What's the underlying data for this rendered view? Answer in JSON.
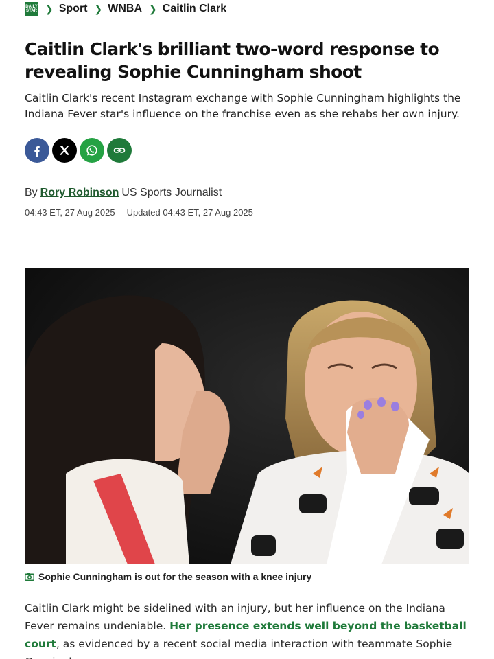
{
  "breadcrumb": {
    "logo_lines": [
      "DAILY",
      "STAR"
    ],
    "items": [
      "Sport",
      "WNBA",
      "Caitlin Clark"
    ]
  },
  "article": {
    "title": "Caitlin Clark's brilliant two-word response to revealing Sophie Cunningham shoot",
    "standfirst": "Caitlin Clark's recent Instagram exchange with Sophie Cunningham highlights the Indiana Fever star's influence on the franchise even as she rehabs her own injury.",
    "byline_prefix": "By",
    "author": "Rory Robinson",
    "author_role": "US Sports Journalist",
    "published": "04:43 ET, 27 Aug 2025",
    "updated": "Updated 04:43 ET, 27 Aug 2025",
    "caption": "Sophie Cunningham is out for the season with a knee injury",
    "body_before": "Caitlin Clark might be sidelined with an injury, but her influence on the Indiana Fever remains undeniable. ",
    "body_link": "Her presence extends well beyond the basketball court",
    "body_after": ", as evidenced by a recent social media interaction with teammate Sophie Cunningham."
  },
  "share": [
    "facebook-icon",
    "x-icon",
    "whatsapp-icon",
    "link-icon"
  ],
  "colors": {
    "brand_green": "#1f7a3a",
    "facebook": "#3b5998",
    "x": "#000000",
    "whatsapp": "#25a244"
  }
}
